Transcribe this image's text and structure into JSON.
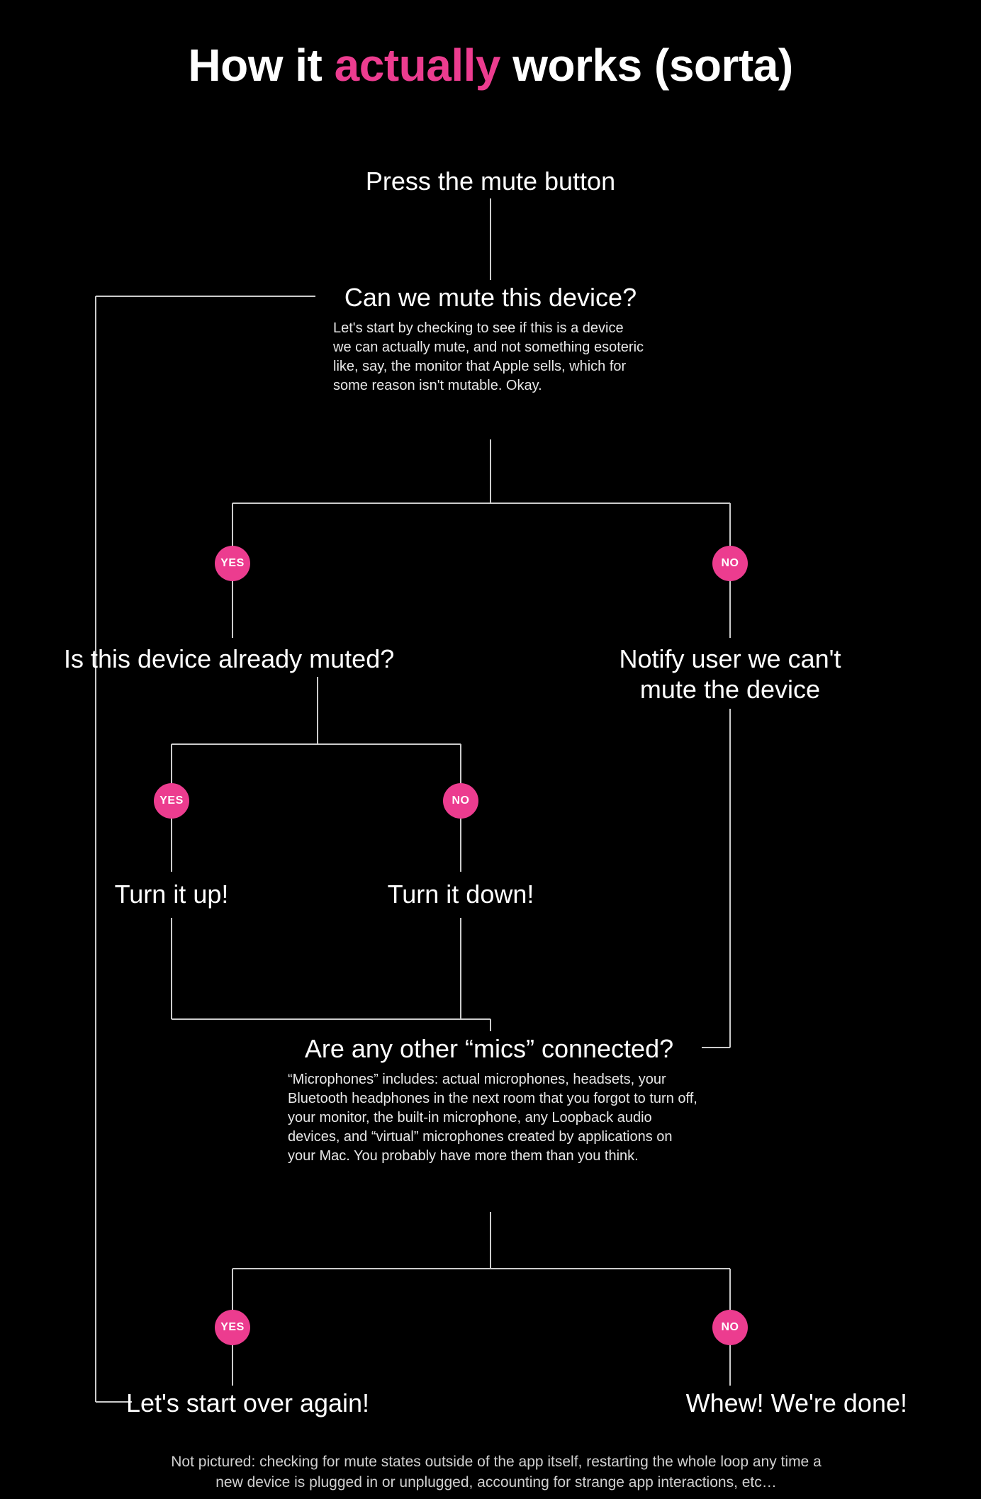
{
  "title": {
    "pre": "How it ",
    "accent": "actually",
    "post": " works (sorta)"
  },
  "nodes": {
    "press": "Press the mute button",
    "can_mute": "Can we mute this device?",
    "can_mute_sub": "Let's start by checking to see if this is a device we can actually mute, and not something esoteric like, say, the monitor that Apple sells, which for some reason isn't mutable. Okay.",
    "already_muted": "Is this device already muted?",
    "notify": "Notify user we can't mute the device",
    "turn_up": "Turn it up!",
    "turn_down": "Turn it down!",
    "other_mics": "Are any other “mics” connected?",
    "other_mics_sub": "“Microphones” includes: actual microphones, headsets, your Bluetooth headphones in the next room that you forgot to turn off, your monitor, the built-in microphone, any Loopback audio devices, and “virtual” microphones created by applications on your Mac. You probably have more them than you think.",
    "start_over": "Let's start over again!",
    "done": "Whew! We're done!"
  },
  "badges": {
    "yes": "YES",
    "no": "NO"
  },
  "footnote": "Not pictured: checking for mute states outside of the app itself, restarting the whole loop any time a new device is plugged in or unplugged, accounting for strange app interactions, etc…"
}
